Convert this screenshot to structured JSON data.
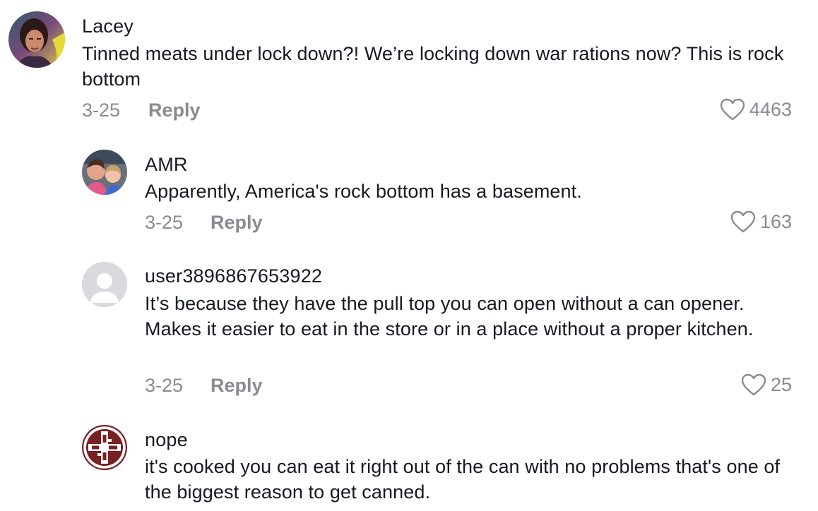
{
  "comments": [
    {
      "username": "Lacey",
      "text": "Tinned meats under lock down?! We’re locking down war rations now? This is rock bottom",
      "date": "3-25",
      "reply_label": "Reply",
      "likes": "4463",
      "avatar_icon": "user-photo-avatar"
    },
    {
      "username": "AMR",
      "text": "Apparently, America's rock bottom has a basement.",
      "date": "3-25",
      "reply_label": "Reply",
      "likes": "163",
      "avatar_icon": "user-photo-avatar"
    },
    {
      "username": "user3896867653922",
      "text": "It’s because they have the pull top you can open without a can opener. Makes it easier to eat in the store or in a place without a proper kitchen.",
      "date": "3-25",
      "reply_label": "Reply",
      "likes": "25",
      "avatar_icon": "default-person-avatar"
    },
    {
      "username": "nope",
      "text": "it's cooked you can eat it right out of the can with no problems that's one of the biggest reason to get canned.",
      "avatar_icon": "red-cross-logo-avatar"
    }
  ],
  "colors": {
    "text_primary": "#161823",
    "text_secondary": "#8a8b91",
    "avatar_placeholder": "#d9d9de",
    "logo_red": "#7a1f22"
  }
}
